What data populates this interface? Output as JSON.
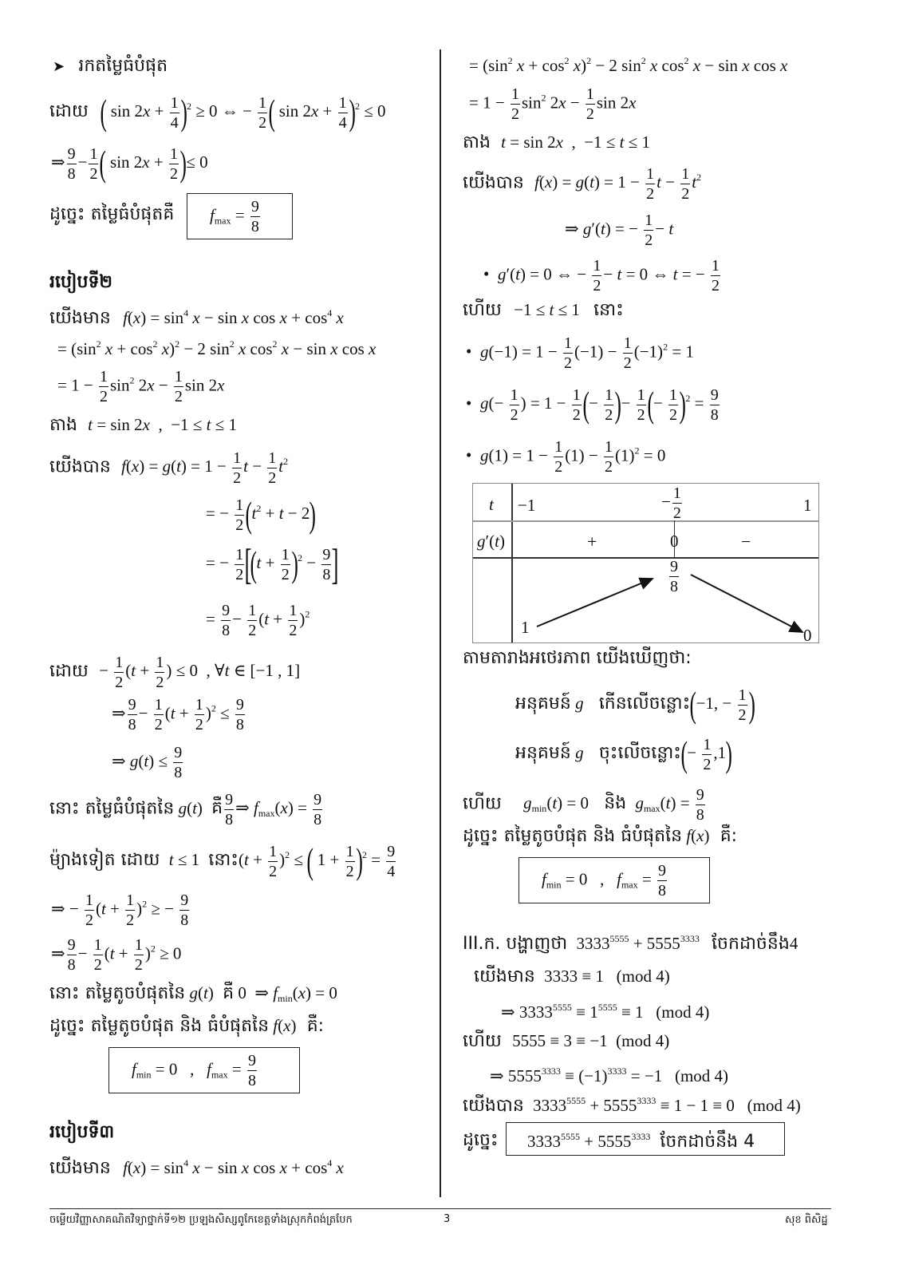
{
  "left": {
    "find_max_heading": "រកតម្លៃធំបំផុត",
    "because": "ដោយ",
    "conclusion_max": "ដូច្នេះ តម្លៃធំបំផុតគឺ",
    "boxed_max": {
      "f": "f",
      "sub": "max",
      "num": "9",
      "den": "8"
    },
    "method2_heading": "របៀបទី២",
    "we_have": "យើងមាន",
    "let": "តាង",
    "we_get": "យើងបាន",
    "because2": "ដោយ",
    "then_max": "នោះ តម្លៃធំបំផុតនៃ",
    "is": "គឺ",
    "on_other_hand": "ម៉្យាងទៀត ដោយ",
    "then": "នោះ",
    "then_min": "នោះ តម្លៃតូចបំផុតនៃ",
    "is0": "គឺ",
    "conclusion_both": "ដូច្នេះ តម្លៃតូចបំផុត និង ធំបំផុតនៃ",
    "colon_is": "គឺ:",
    "boxed_both": {
      "min_label": "min",
      "min_value": "0",
      "max_label": "max",
      "num": "9",
      "den": "8"
    },
    "method3_heading": "របៀបទី៣",
    "we_have3": "យើងមាន"
  },
  "right": {
    "let": "តាង",
    "we_get": "យើងបាន",
    "and_then": "ហើយ",
    "then": "នោះ",
    "variation_table": {
      "row_labels": [
        "t",
        "g′(t)",
        ""
      ],
      "t_values": [
        "−1",
        "−1/2",
        "1"
      ],
      "sign": [
        "+",
        "0",
        "−"
      ],
      "g_values": {
        "start": "1",
        "peak_num": "9",
        "peak_den": "8",
        "end": "0"
      }
    },
    "from_table": "តាមតារាងអថេរភាព យើងឃើញថា:",
    "func_g": "អនុគមន៍",
    "increasing_on": "កើនលើចន្លោះ",
    "decreasing_on": "ចុះលើចន្លោះ",
    "and_then2": "ហើយ",
    "and": "និង",
    "conclusion_both": "ដូច្នេះ តម្លៃតូចបំផុត និង ធំបំផុតនៃ",
    "colon_is": "គឺ:",
    "boxed_both": {
      "min_label": "min",
      "min_value": "0",
      "max_label": "max",
      "num": "9",
      "den": "8"
    },
    "section3_label": "III.ក. បង្ហាញថា",
    "divisible_by": "ចែកដាច់នឹង",
    "four": "4",
    "we_have": "យើងមាន",
    "and_then3": "ហើយ",
    "we_get2": "យើងបាន",
    "therefore": "ដូច្នេះ",
    "boxed_conclusion": "ចែកដាច់នឹង 4"
  },
  "footer": {
    "title": "ចម្លើយវិញ្ញាសាគណិតវិទ្យាថ្នាក់ទី១២  ប្រឡងសិស្សពូកែខេត្តទាំងស្រុកកំពង់ត្របែក",
    "page_number": "3",
    "author": "សុខ ពិសិដ្ឋ"
  }
}
